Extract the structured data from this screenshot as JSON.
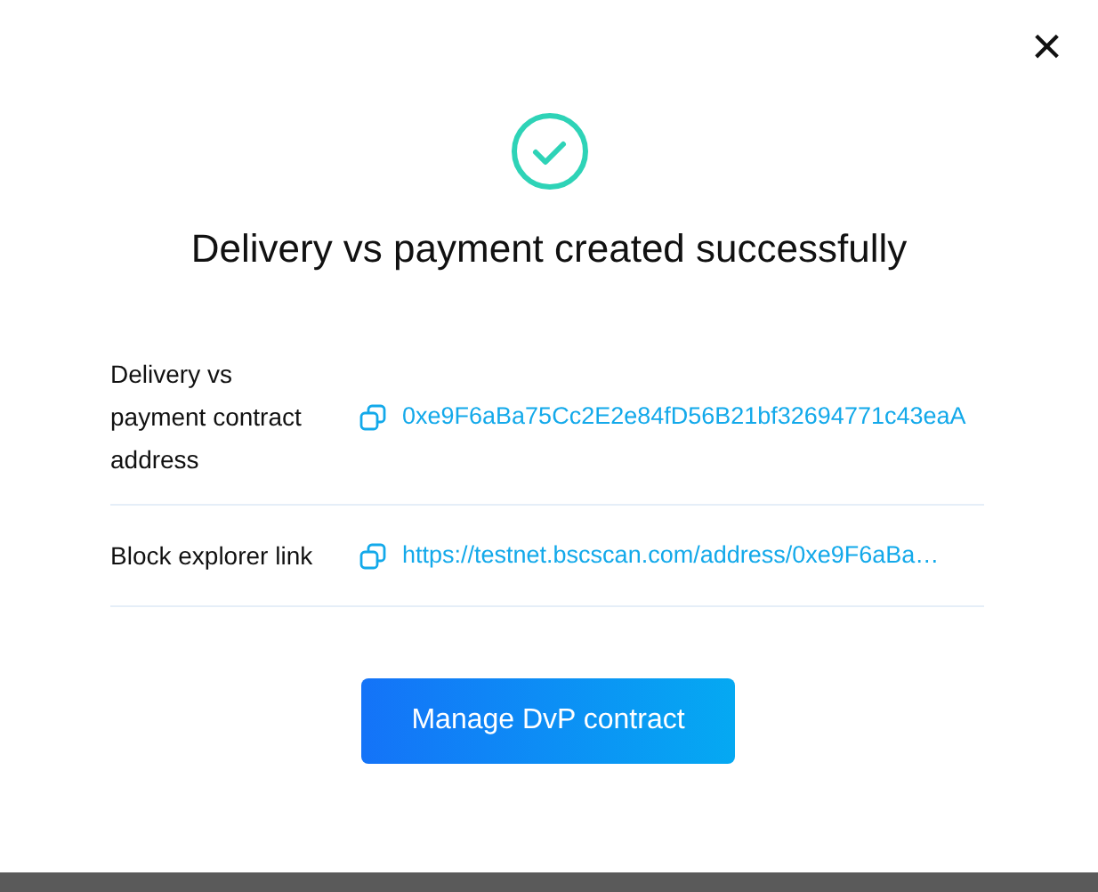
{
  "dialog": {
    "close_label": "×",
    "title": "Delivery vs payment created successfully",
    "details": [
      {
        "label": "Delivery vs payment contract address",
        "value": "0xe9F6aBa75Cc2E2e84fD56B21bf32694771c43eaA"
      },
      {
        "label": "Block explorer link",
        "value": "https://testnet.bscscan.com/address/0xe9F6aBa…"
      }
    ],
    "button": "Manage DvP contract"
  }
}
